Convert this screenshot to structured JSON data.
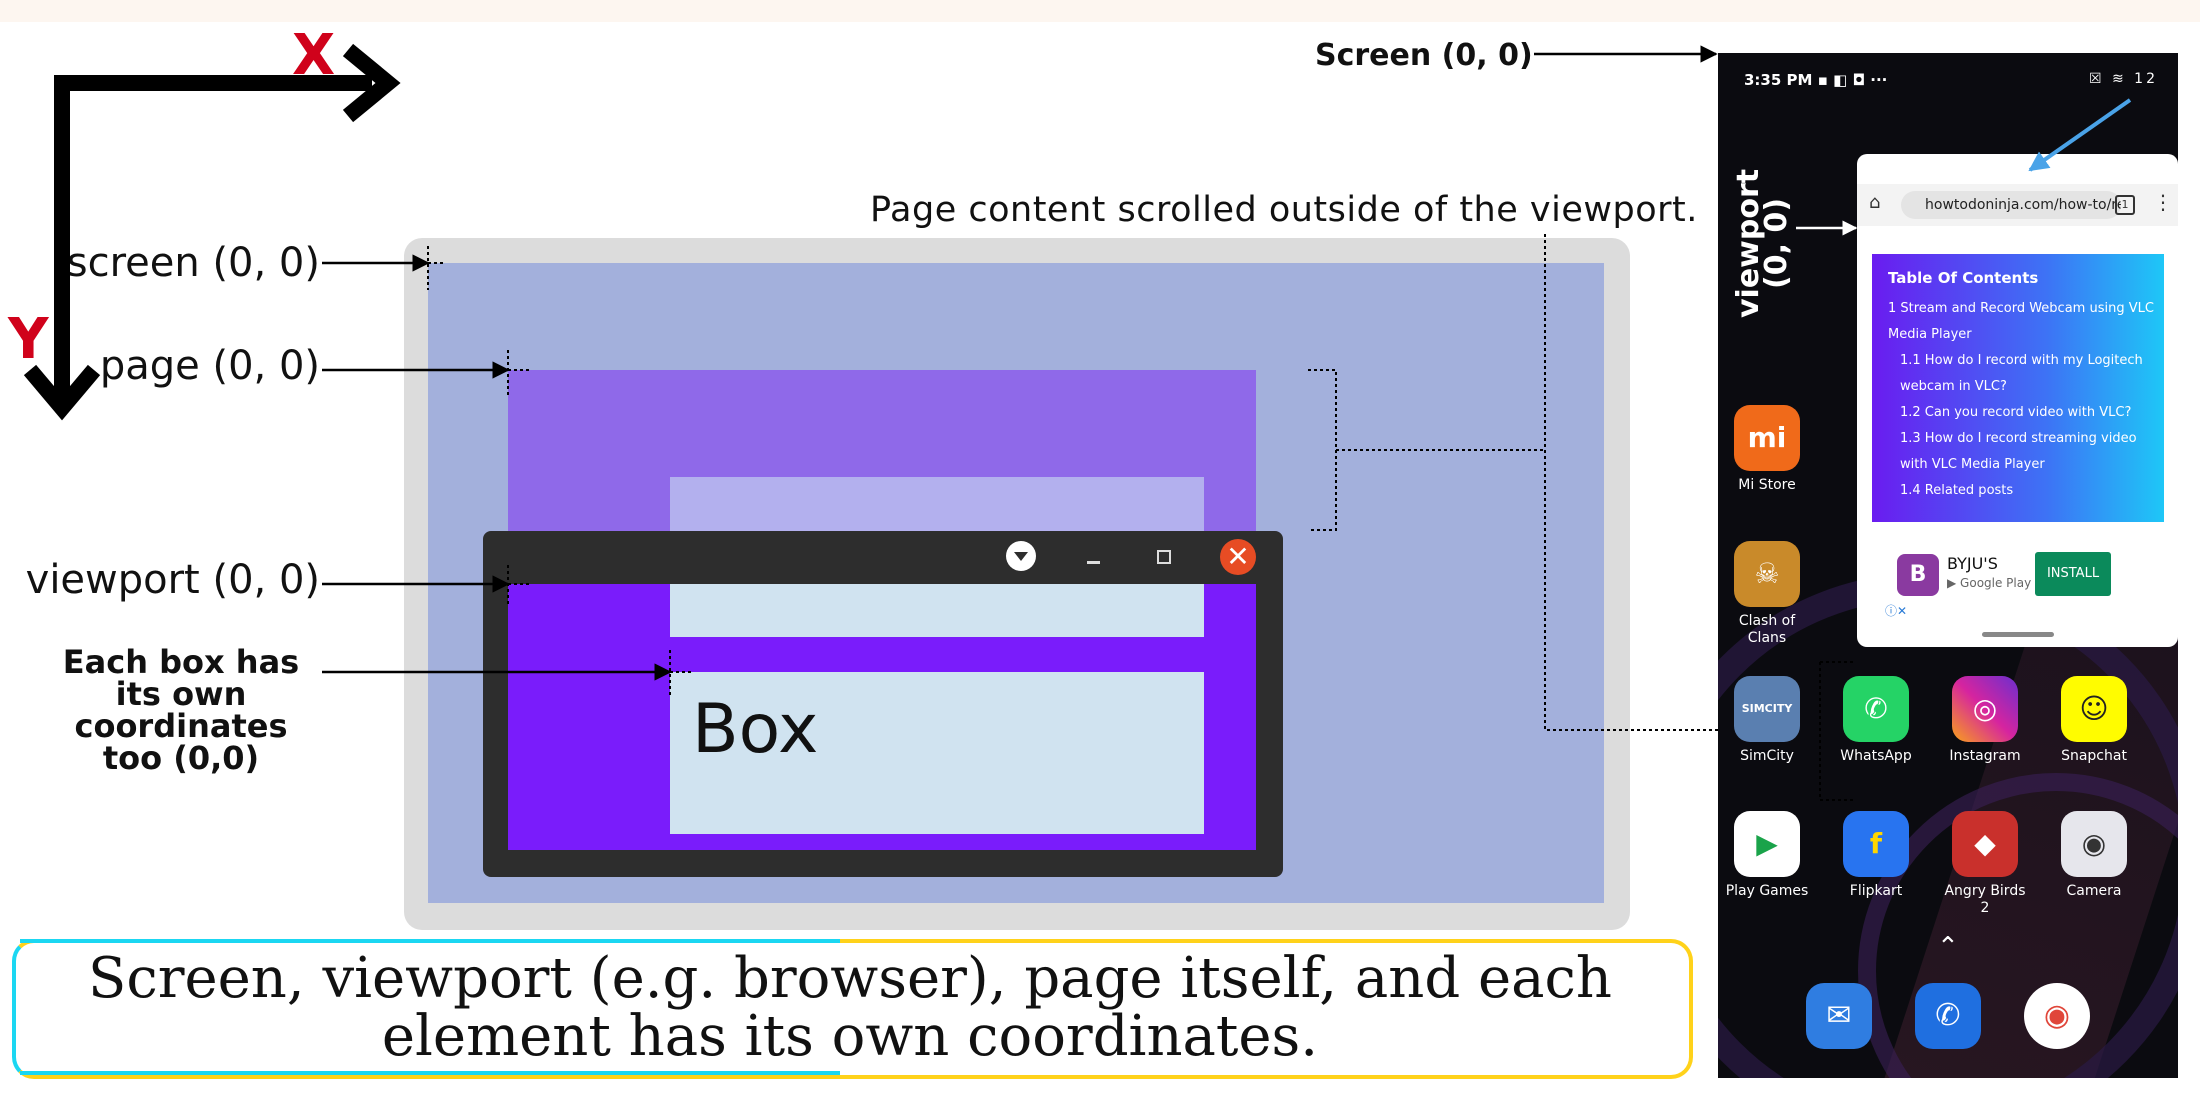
{
  "axes": {
    "x_label": "X",
    "y_label": "Y"
  },
  "labels": {
    "screen": "screen (0, 0)",
    "page": "page (0, 0)",
    "viewport": "viewport (0, 0)",
    "each_box": "Each box has its own coordinates too (0,0)",
    "scroll_note": "Page content scrolled outside of the viewport.",
    "phone_screen": "Screen (0, 0)",
    "phone_viewport_line1": "viewport",
    "phone_viewport_line2": "(0, 0)"
  },
  "box_label": "Box",
  "caption": "Screen, viewport (e.g. browser), page itself, and each element has its own coordinates.",
  "window_buttons": {
    "close": "✕"
  },
  "phone": {
    "status_time": "3:35 PM",
    "battery": "12",
    "url": "howtodoninja.com/how-to/re",
    "tabs_count": "1",
    "toc_title": "Table Of Contents",
    "toc_items": [
      "1 Stream and Record Webcam using VLC Media Player",
      "1.1 How do I record with my Logitech webcam in VLC?",
      "1.2 Can you record video with VLC?",
      "1.3 How do I record streaming video with VLC Media Player",
      "1.4 Related posts"
    ],
    "ad": {
      "name": "BYJU'S",
      "sub": "Google Play",
      "button": "INSTALL"
    },
    "apps": [
      {
        "label": "Mi Store",
        "color": "#f06a1a",
        "glyph": "mi"
      },
      {
        "label": "Clash of Clans",
        "color": "#c98a2a",
        "glyph": "☠"
      },
      {
        "label": "SimCity",
        "color": "#5a7fb0",
        "glyph": "SIMCITY"
      },
      {
        "label": "WhatsApp",
        "color": "#25d366",
        "glyph": "✆"
      },
      {
        "label": "Instagram",
        "color": "#d6249f",
        "glyph": "◎"
      },
      {
        "label": "Snapchat",
        "color": "#fffc00",
        "glyph": "👻"
      },
      {
        "label": "Play Games",
        "color": "#ffffff",
        "glyph": "▶"
      },
      {
        "label": "Flipkart",
        "color": "#2874f0",
        "glyph": "f"
      },
      {
        "label": "Angry Birds 2",
        "color": "#c9302c",
        "glyph": "◆"
      },
      {
        "label": "Camera",
        "color": "#e6e6ec",
        "glyph": "◉"
      }
    ],
    "dock": [
      {
        "name": "messages",
        "color": "#2f7de1",
        "glyph": "✉"
      },
      {
        "name": "phone",
        "color": "#1f6fe0",
        "glyph": "✆"
      },
      {
        "name": "chrome",
        "color": "#ffffff",
        "glyph": "◉"
      }
    ]
  },
  "colors": {
    "screen": "#a3b0dc",
    "page": "#8f69e9",
    "viewport_content": "#7a1cfb",
    "box": "#d0e3f0",
    "axis_letters": "#d0021b",
    "caption_border_left": "#1bd7f2",
    "caption_border_right": "#ffd21a"
  }
}
